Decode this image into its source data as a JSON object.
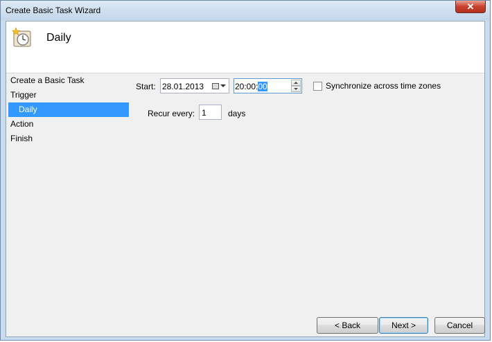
{
  "window": {
    "title": "Create Basic Task Wizard",
    "close_symbol": "✕"
  },
  "header": {
    "title": "Daily",
    "icon": "calendar-clock-icon"
  },
  "nav": {
    "items": [
      {
        "label": "Create a Basic Task"
      },
      {
        "label": "Trigger"
      },
      {
        "label": "Daily",
        "selected": true
      },
      {
        "label": "Action"
      },
      {
        "label": "Finish"
      }
    ]
  },
  "form": {
    "start_label": "Start:",
    "start_date": "28.01.2013",
    "start_time_prefix": "20:00:",
    "start_time_selected": "00",
    "sync_label": "Synchronize across time zones",
    "sync_checked": false,
    "recur_label": "Recur every:",
    "recur_value": "1",
    "recur_unit": "days"
  },
  "buttons": {
    "back": "< Back",
    "next": "Next >",
    "cancel": "Cancel"
  },
  "colors": {
    "selection": "#3399ff",
    "frame": "#c9dcee",
    "close": "#c8412d"
  }
}
